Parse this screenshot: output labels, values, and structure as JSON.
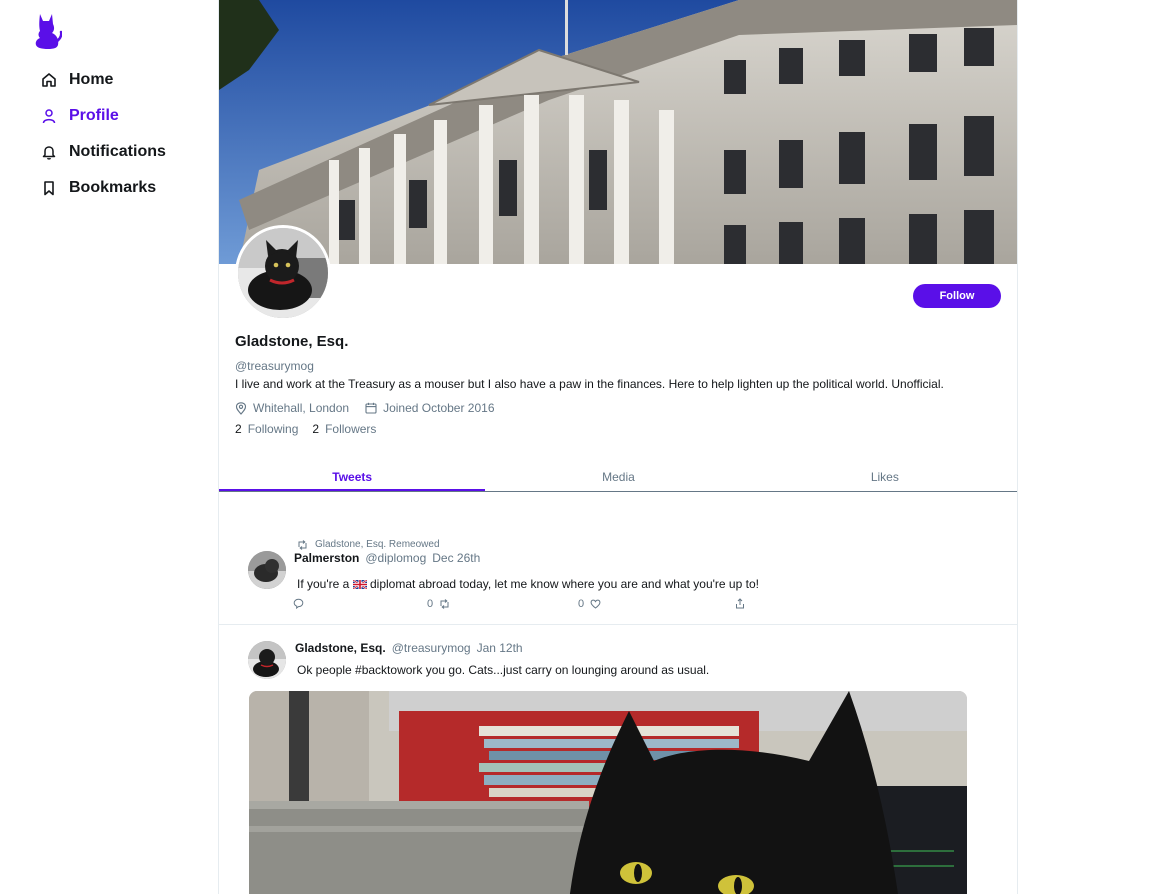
{
  "sidebar": {
    "logo_icon": "cat-logo-icon",
    "items": [
      {
        "label": "Home",
        "icon": "home-icon"
      },
      {
        "label": "Profile",
        "icon": "user-icon",
        "active": true
      },
      {
        "label": "Notifications",
        "icon": "bell-icon"
      },
      {
        "label": "Bookmarks",
        "icon": "bookmark-icon"
      }
    ]
  },
  "profile": {
    "name": "Gladstone, Esq.",
    "handle": "@treasurymog",
    "bio": "I live and work at the Treasury as a mouser but I also have a paw in the finances. Here to help lighten up the political world. Unofficial.",
    "location": "Whitehall, London",
    "joined": "Joined October 2016",
    "following_count": "2",
    "following_label": "Following",
    "followers_count": "2",
    "followers_label": "Followers",
    "follow_button": "Follow"
  },
  "tabs": [
    {
      "label": "Tweets",
      "active": true
    },
    {
      "label": "Media"
    },
    {
      "label": "Likes"
    }
  ],
  "tweets": [
    {
      "retweeted_by": "Gladstone, Esq. Remeowed",
      "name": "Palmerston",
      "handle": "@diplomog",
      "date": "Dec 26th",
      "text_before_flag": "If you're a ",
      "text_after_flag": " diplomat abroad today, let me know where you are and what you're up to!",
      "retweets": "0",
      "likes": "0"
    },
    {
      "name": "Gladstone, Esq.",
      "handle": "@treasurymog",
      "date": "Jan 12th",
      "text": "Ok people #backtowork you go. Cats...just carry on lounging around as usual."
    }
  ],
  "colors": {
    "accent": "#5a0fe8",
    "muted": "#657786",
    "border": "#e6ecf0"
  }
}
